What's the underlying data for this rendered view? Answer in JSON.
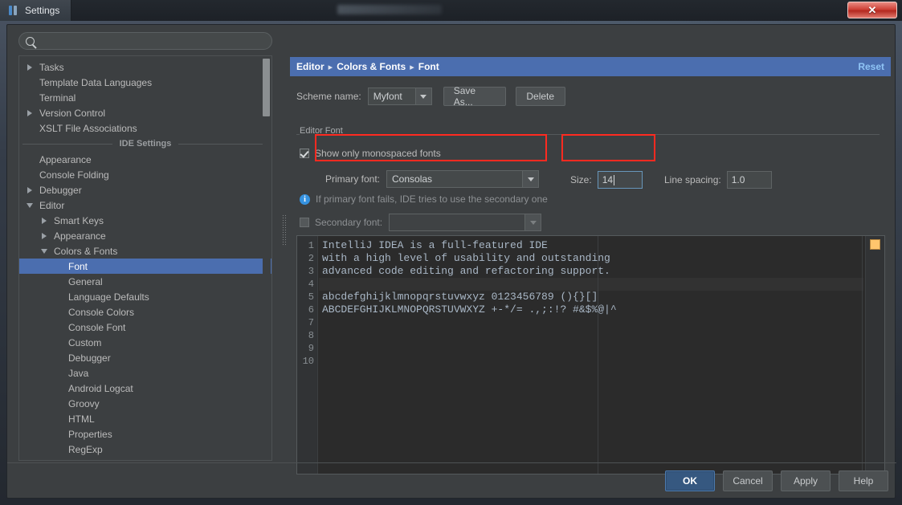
{
  "window": {
    "title": "Settings",
    "close_label": "✕"
  },
  "sidebar": {
    "search_placeholder": "",
    "search_value": "",
    "search_icon": "search-icon",
    "items": [
      {
        "label": "Tasks",
        "indent": 0,
        "arrow": "right"
      },
      {
        "label": "Template Data Languages",
        "indent": 0,
        "arrow": "none"
      },
      {
        "label": "Terminal",
        "indent": 0,
        "arrow": "none"
      },
      {
        "label": "Version Control",
        "indent": 0,
        "arrow": "right"
      },
      {
        "label": "XSLT File Associations",
        "indent": 0,
        "arrow": "none"
      },
      {
        "label": "IDE Settings",
        "indent": 0,
        "arrow": "section"
      },
      {
        "label": "Appearance",
        "indent": 0,
        "arrow": "none"
      },
      {
        "label": "Console Folding",
        "indent": 0,
        "arrow": "none"
      },
      {
        "label": "Debugger",
        "indent": 0,
        "arrow": "right"
      },
      {
        "label": "Editor",
        "indent": 0,
        "arrow": "down"
      },
      {
        "label": "Smart Keys",
        "indent": 1,
        "arrow": "right"
      },
      {
        "label": "Appearance",
        "indent": 1,
        "arrow": "right"
      },
      {
        "label": "Colors & Fonts",
        "indent": 1,
        "arrow": "down"
      },
      {
        "label": "Font",
        "indent": 2,
        "arrow": "none",
        "selected": true
      },
      {
        "label": "General",
        "indent": 2,
        "arrow": "none"
      },
      {
        "label": "Language Defaults",
        "indent": 2,
        "arrow": "none"
      },
      {
        "label": "Console Colors",
        "indent": 2,
        "arrow": "none"
      },
      {
        "label": "Console Font",
        "indent": 2,
        "arrow": "none"
      },
      {
        "label": "Custom",
        "indent": 2,
        "arrow": "none"
      },
      {
        "label": "Debugger",
        "indent": 2,
        "arrow": "none"
      },
      {
        "label": "Java",
        "indent": 2,
        "arrow": "none"
      },
      {
        "label": "Android Logcat",
        "indent": 2,
        "arrow": "none"
      },
      {
        "label": "Groovy",
        "indent": 2,
        "arrow": "none"
      },
      {
        "label": "HTML",
        "indent": 2,
        "arrow": "none"
      },
      {
        "label": "Properties",
        "indent": 2,
        "arrow": "none"
      },
      {
        "label": "RegExp",
        "indent": 2,
        "arrow": "none"
      }
    ]
  },
  "breadcrumb": {
    "part1": "Editor",
    "sep1": "▸",
    "part2": "Colors & Fonts",
    "sep2": "▸",
    "part3": "Font",
    "reset_label": "Reset"
  },
  "scheme": {
    "label": "Scheme name:",
    "value": "Myfont",
    "save_as_label": "Save As...",
    "delete_label": "Delete"
  },
  "editor_font": {
    "group_title": "Editor Font",
    "monospaced_label": "Show only monospaced fonts",
    "monospaced_checked": true,
    "primary_label": "Primary font:",
    "primary_value": "Consolas",
    "size_label": "Size:",
    "size_value": "14",
    "line_spacing_label": "Line spacing:",
    "line_spacing_value": "1.0",
    "hint_text": "If primary font fails, IDE tries to use the secondary one",
    "secondary_label": "Secondary font:",
    "secondary_value": "",
    "secondary_checked": false
  },
  "preview": {
    "line_numbers": [
      "1",
      "2",
      "3",
      "4",
      "5",
      "6",
      "7",
      "8",
      "9",
      "10"
    ],
    "lines": [
      "IntelliJ IDEA is a full-featured IDE",
      "with a high level of usability and outstanding",
      "advanced code editing and refactoring support.",
      "",
      "abcdefghijklmnopqrstuvwxyz 0123456789 (){}[]",
      "ABCDEFGHIJKLMNOPQRSTUVWXYZ +-*/= .,;:!? #&$%@|^",
      "",
      "",
      "",
      ""
    ],
    "current_line_index": 3,
    "marker_color": "#ffc66d"
  },
  "footer": {
    "ok": "OK",
    "cancel": "Cancel",
    "apply": "Apply",
    "help": "Help"
  },
  "colors": {
    "accent": "#4b6eaf",
    "annotation": "#ff2a20",
    "panel": "#3c3f41",
    "editor_bg": "#2b2b2b",
    "link": "#8fc4f5"
  }
}
